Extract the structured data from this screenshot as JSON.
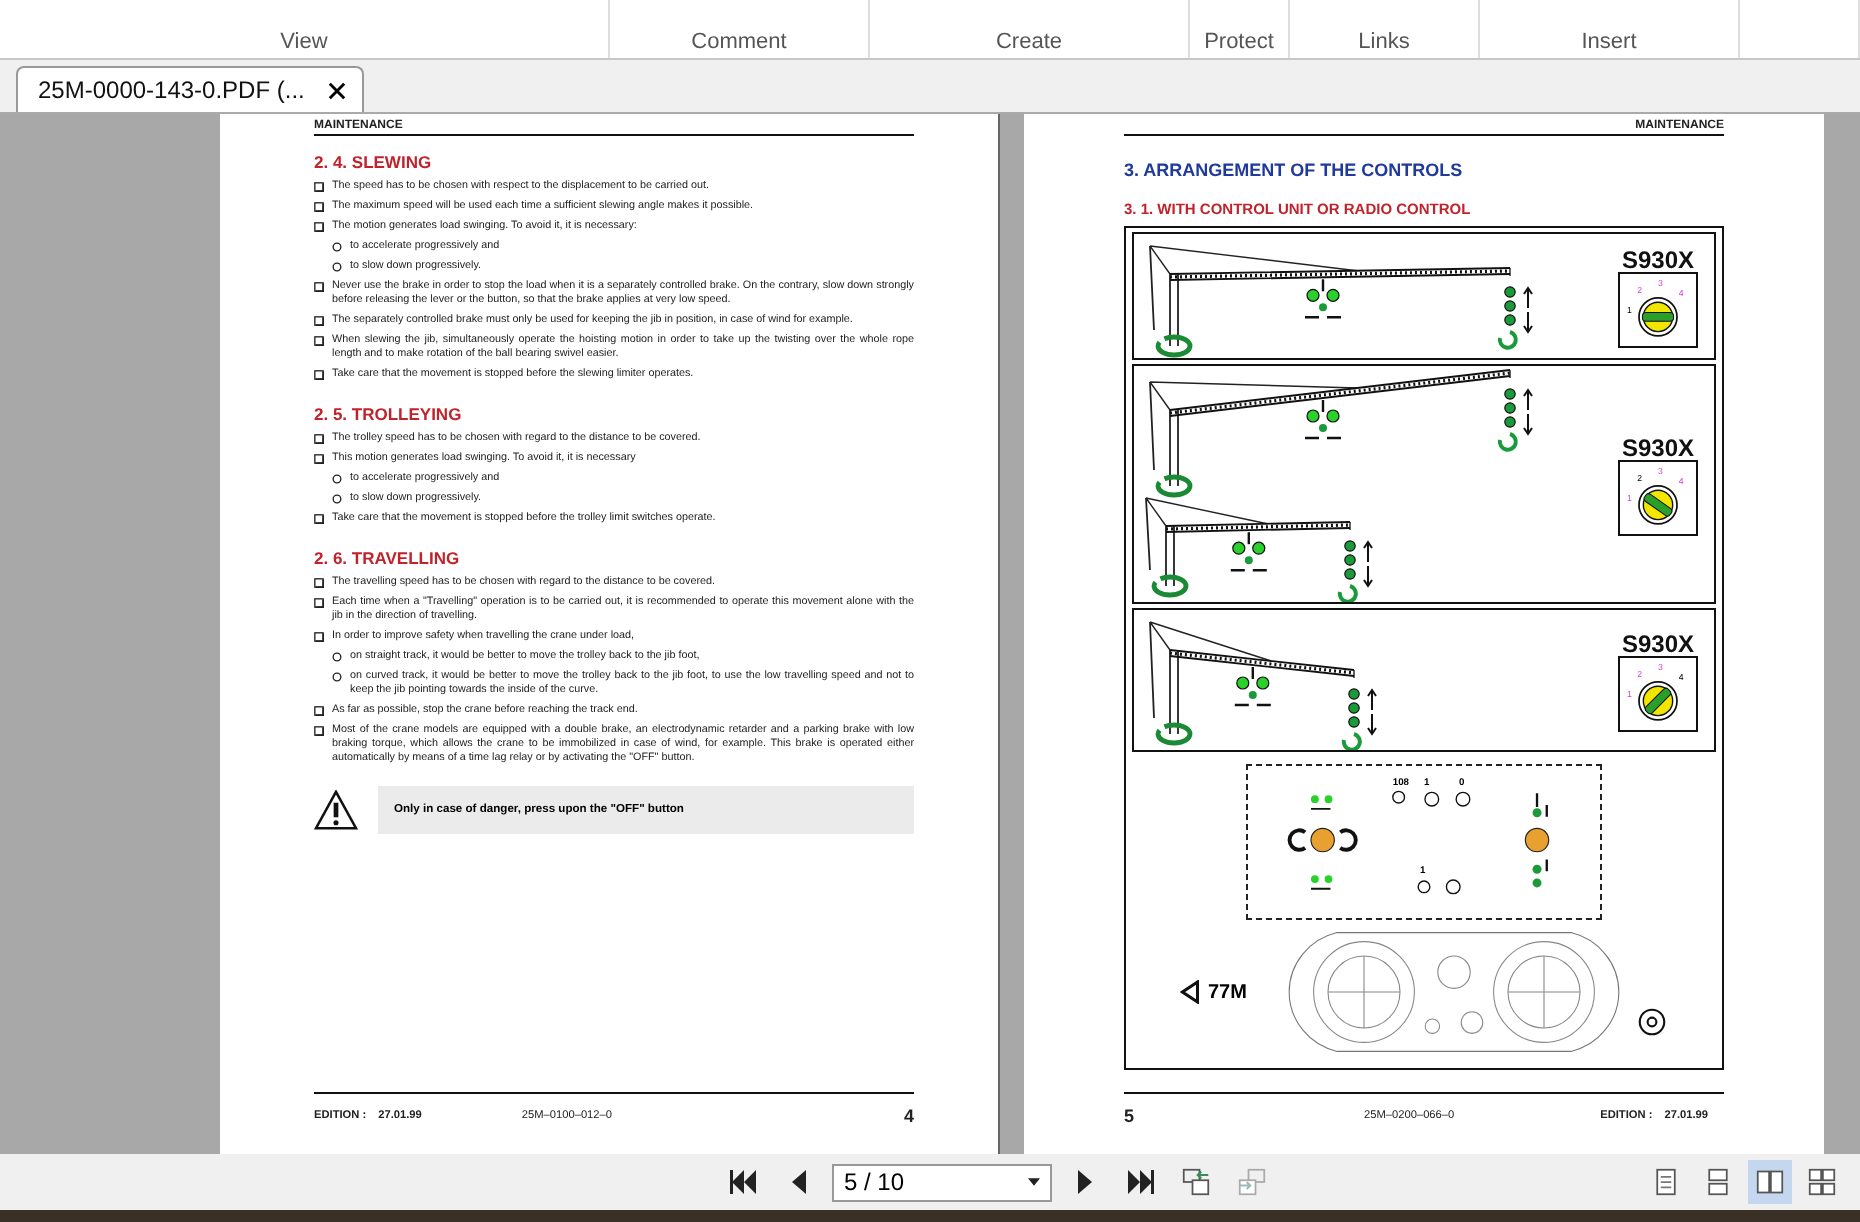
{
  "ribbon": {
    "groups": [
      "View",
      "Comment",
      "Create",
      "Protect",
      "Links",
      "Insert"
    ]
  },
  "tabs": [
    {
      "label": "25M-0000-143-0.PDF (...",
      "selected": true
    }
  ],
  "pages": [
    {
      "header": "MAINTENANCE",
      "sections": [
        {
          "heading": "2. 4. SLEWING",
          "items": [
            {
              "kind": "bullet",
              "text": "The speed has to be chosen with respect to the displacement to be carried out."
            },
            {
              "kind": "bullet",
              "text": "The maximum speed will be used each time a sufficient slewing angle makes it possible."
            },
            {
              "kind": "bullet",
              "text": "The motion generates load swinging. To avoid it, it is necessary:"
            },
            {
              "kind": "sub",
              "text": "to accelerate progressively and"
            },
            {
              "kind": "sub",
              "text": "to slow down progressively."
            },
            {
              "kind": "bullet",
              "text": "Never use the brake in order to stop the load when it is a separately controlled brake. On the contrary, slow down strongly before releasing the lever or the button, so that the brake applies at very low speed."
            },
            {
              "kind": "bullet",
              "text": "The separately controlled brake must only be used for keeping the jib in position, in case of wind for example."
            },
            {
              "kind": "bullet",
              "text": "When slewing the jib, simultaneously operate the hoisting motion in order to take up the twisting over the whole rope length and to make rotation of the ball bearing swivel easier."
            },
            {
              "kind": "bullet",
              "text": "Take care that the movement is stopped before the slewing limiter operates."
            }
          ]
        },
        {
          "heading": "2. 5. TROLLEYING",
          "items": [
            {
              "kind": "bullet",
              "text": "The trolley speed has to be chosen with regard to the distance to be covered."
            },
            {
              "kind": "bullet",
              "text": "This motion generates load swinging. To avoid it, it is necessary"
            },
            {
              "kind": "sub",
              "text": "to accelerate progressively and"
            },
            {
              "kind": "sub",
              "text": "to slow down progressively."
            },
            {
              "kind": "bullet",
              "text": "Take care that the movement is stopped before the trolley limit switches operate."
            }
          ]
        },
        {
          "heading": "2. 6. TRAVELLING",
          "items": [
            {
              "kind": "bullet",
              "text": "The travelling speed has to be chosen with regard to the distance to be covered."
            },
            {
              "kind": "bullet",
              "text": "Each time when a \"Travelling\" operation is to be carried out, it is recommended to operate this movement alone with the jib in the direction of travelling."
            },
            {
              "kind": "bullet",
              "text": "In order to improve safety when travelling the crane under load,"
            },
            {
              "kind": "sub",
              "text": "on straight track, it would be better to move the trolley back to the jib foot,"
            },
            {
              "kind": "sub",
              "text": "on curved track, it would be better to move the trolley back to the jib foot, to use the low travelling speed and not to keep the jib pointing towards the inside of the curve."
            },
            {
              "kind": "bullet",
              "text": "As far as possible, stop the crane before reaching the track end."
            },
            {
              "kind": "bullet",
              "text": "Most of the crane models are equipped with a double brake, an electrodynamic retarder and a parking brake with low braking torque, which allows the crane to be immobilized in case of wind, for example. This brake is operated either automatically by means of a time lag relay or by activating the \"OFF\" button."
            }
          ]
        }
      ],
      "warning": "Only in case of danger, press upon the \"OFF\" button",
      "footer": {
        "edition_label": "EDITION :",
        "edition_date": "27.01.99",
        "code": "25M–0100–012–0",
        "page_number": "4"
      }
    },
    {
      "header": "MAINTENANCE",
      "title": "3. ARRANGEMENT OF THE CONTROLS",
      "subtitle": "3. 1. WITH CONTROL UNIT OR RADIO CONTROL",
      "panels": [
        {
          "kind": "horizontal",
          "model": "S930X",
          "dial": [
            {
              "label": "1",
              "selected": true
            },
            {
              "label": "2",
              "selected": false
            },
            {
              "label": "3",
              "selected": false
            },
            {
              "label": "4",
              "selected": false
            }
          ]
        },
        {
          "kind": "raised",
          "model": "S930X",
          "dial": [
            {
              "label": "1",
              "selected": false
            },
            {
              "label": "2",
              "selected": true
            },
            {
              "label": "3",
              "selected": false
            },
            {
              "label": "4",
              "selected": false
            }
          ]
        },
        {
          "kind": "luffed",
          "model": "S930X",
          "dial": [
            {
              "label": "1",
              "selected": false
            },
            {
              "label": "2",
              "selected": false
            },
            {
              "label": "3",
              "selected": false
            },
            {
              "label": "4",
              "selected": true
            }
          ]
        }
      ],
      "control_box": {
        "labels": [
          "108",
          "1",
          "0",
          "1"
        ]
      },
      "dashboard": {
        "label": "77M"
      },
      "footer": {
        "edition_label": "EDITION :",
        "edition_date": "27.01.99",
        "code": "25M–0200–066–0",
        "page_number": "5"
      }
    }
  ],
  "toolbar": {
    "page_field": "5 / 10",
    "view_modes": [
      {
        "selected": false
      },
      {
        "selected": false
      },
      {
        "selected": true
      },
      {
        "selected": false
      }
    ]
  }
}
